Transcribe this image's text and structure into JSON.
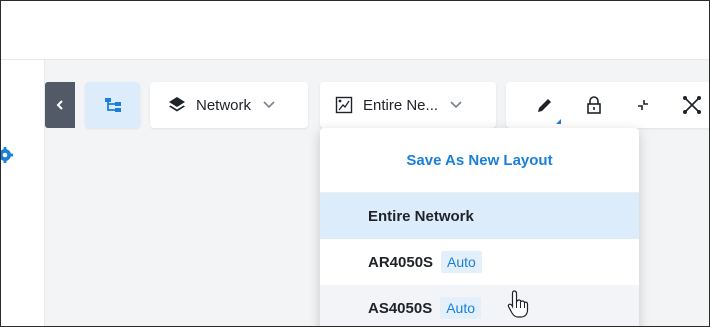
{
  "toolbar": {
    "network_label": "Network",
    "layout_label": "Entire Ne...",
    "icons": [
      "collapse-chevron-left",
      "topology-tree",
      "layers",
      "chevron-down",
      "layout-map",
      "pencil",
      "lock",
      "collapse-arrows",
      "expand-network"
    ]
  },
  "layout_menu": {
    "action_label": "Save As New Layout",
    "items": [
      {
        "name": "Entire Network",
        "badge": ""
      },
      {
        "name": "AR4050S",
        "badge": "Auto"
      },
      {
        "name": "AS4050S",
        "badge": "Auto"
      }
    ]
  },
  "colors": {
    "accent": "#1a7fd9",
    "selected_bg": "#ddecfb",
    "collapse_bg": "#515a66"
  }
}
